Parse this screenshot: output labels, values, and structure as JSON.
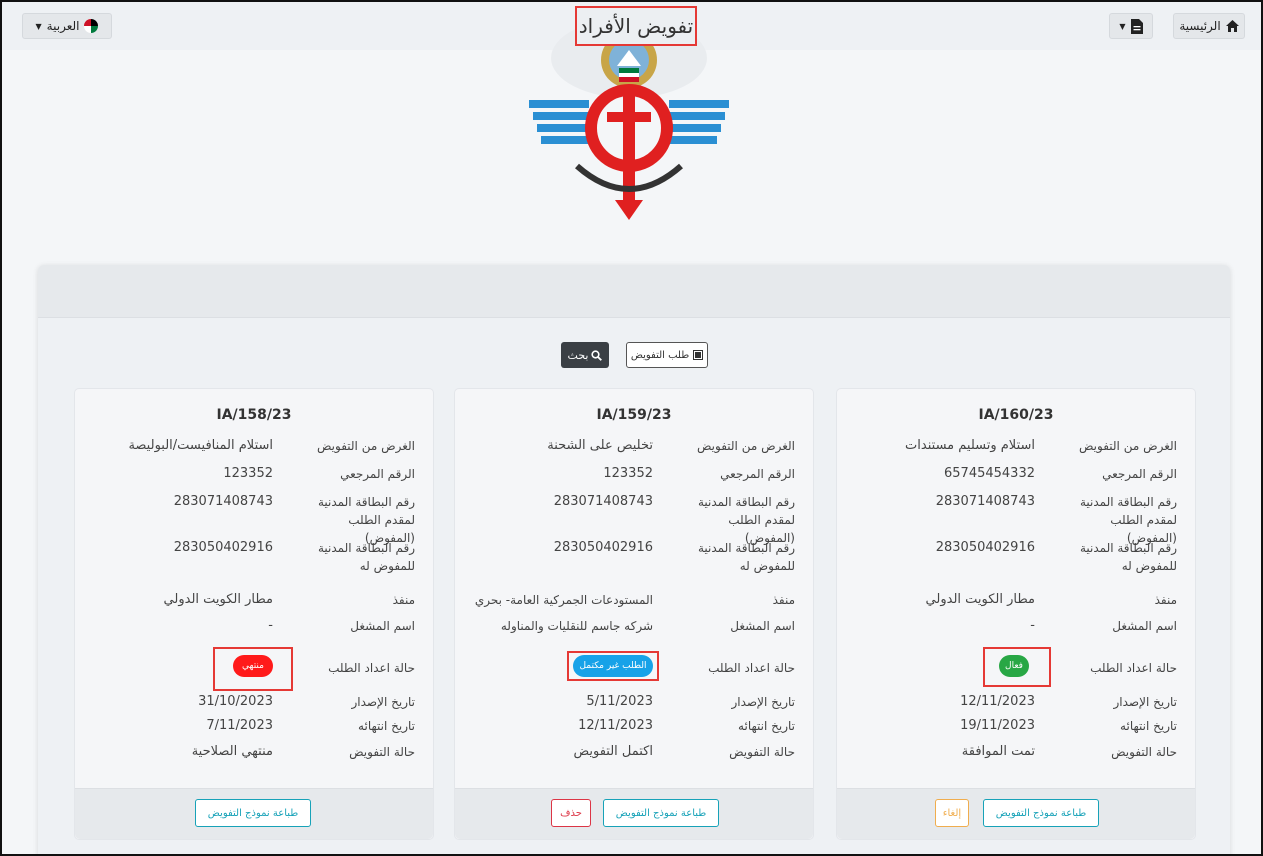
{
  "topbar": {
    "home_label": "الرئيسية",
    "language_label": "العربية"
  },
  "page": {
    "title": "تفويض الأفراد",
    "search_label": "بحث",
    "request_label": "طلب التفويض"
  },
  "labels": {
    "purpose": "الغرض من التفويض",
    "ref": "الرقم المرجعي",
    "civil_requester": "رقم البطاقة المدنية لمقدم الطلب (المفوض)",
    "civil_delegate": "رقم البطاقة المدنية للمفوض له",
    "port": "منفذ",
    "operator": "اسم المشغل",
    "prep_status": "حالة اعداد الطلب",
    "issue_date": "تاريخ الإصدار",
    "expiry_date": "تاريخ انتهائه",
    "delegation_status": "حالة التفويض",
    "print_button": "طباعة نموذج التفويض",
    "cancel_button": "إلغاء",
    "delete_button": "حذف"
  },
  "cards": [
    {
      "id": "IA/160/23",
      "purpose": "استلام وتسليم مستندات",
      "ref": "65745454332",
      "civil_requester": "283071408743",
      "civil_delegate": "283050402916",
      "port": "مطار الكويت الدولي",
      "operator": "-",
      "prep_status": "فعال",
      "prep_status_color": "#28a745",
      "issue_date": "12/11/2023",
      "expiry_date": "19/11/2023",
      "delegation_status": "تمت الموافقة"
    },
    {
      "id": "IA/159/23",
      "purpose": "تخليص على الشحنة",
      "ref": "123352",
      "civil_requester": "283071408743",
      "civil_delegate": "283050402916",
      "port": "المستودعات الجمركية العامة- بحري",
      "operator": "شركه جاسم للنقليات والمناوله",
      "prep_status": "الطلب غير مكتمل",
      "prep_status_color": "#17a2e8",
      "issue_date": "5/11/2023",
      "expiry_date": "12/11/2023",
      "delegation_status": "اكتمل التفويض"
    },
    {
      "id": "IA/158/23",
      "purpose": "استلام المنافيست/البوليصة",
      "ref": "123352",
      "civil_requester": "283071408743",
      "civil_delegate": "283050402916",
      "port": "مطار الكويت الدولي",
      "operator": "-",
      "prep_status": "منتهي",
      "prep_status_color": "#ff1a1a",
      "issue_date": "31/10/2023",
      "expiry_date": "7/11/2023",
      "delegation_status": "منتهي الصلاحية"
    }
  ]
}
